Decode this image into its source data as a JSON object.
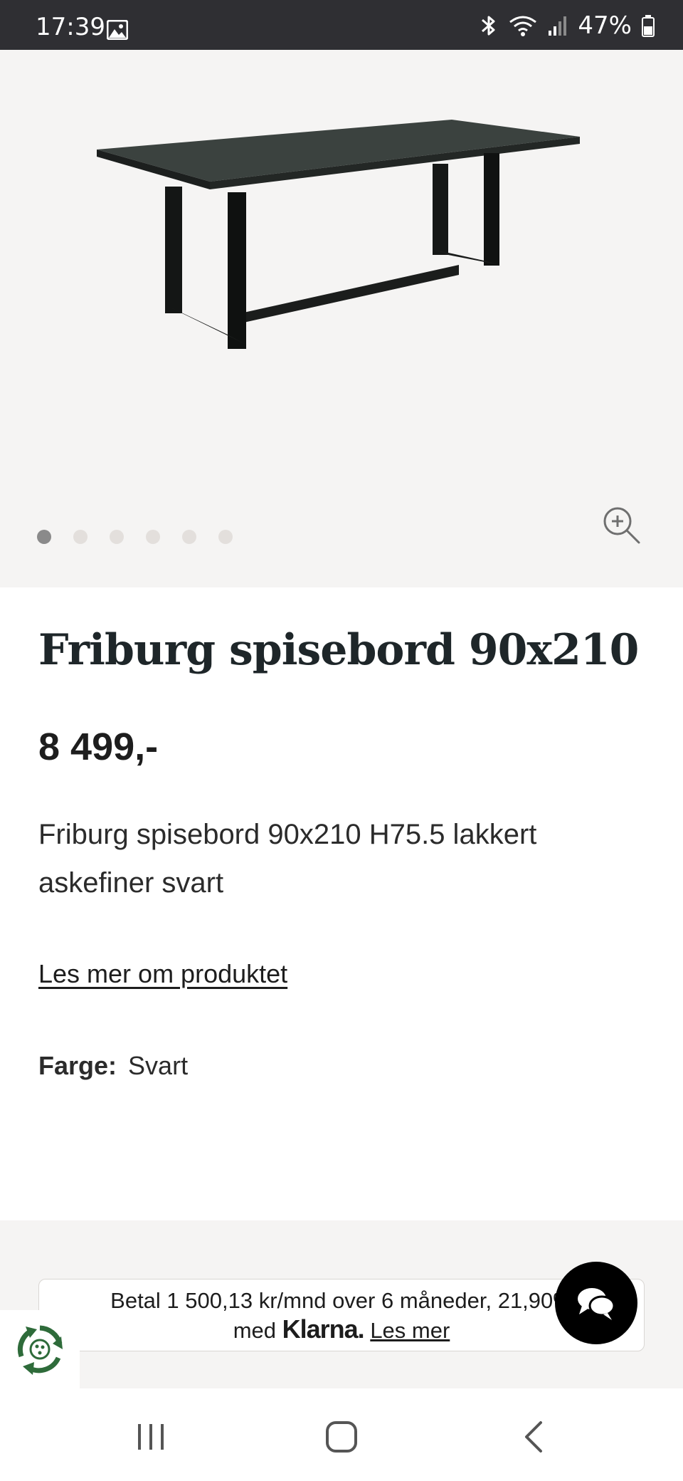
{
  "status_bar": {
    "time": "17:39",
    "battery": "47%",
    "icons": [
      "gallery-icon",
      "bluetooth-icon",
      "wifi-icon",
      "signal-icon",
      "battery-icon"
    ]
  },
  "gallery": {
    "image_alt": "Friburg spisebord",
    "image_count": 6,
    "active_index": 0,
    "zoom_icon": "zoom-in-icon"
  },
  "product": {
    "title": "Friburg spisebord 90x210",
    "price": "8 499,-",
    "description": "Friburg spisebord 90x210 H75.5 lakkert askefiner svart",
    "read_more": "Les mer om produktet",
    "color_label": "Farge:",
    "color_value": "Svart"
  },
  "klarna": {
    "line1": "Betal 1 500,13 kr/mnd over 6 måneder, 21,90%",
    "line2_prefix": "med",
    "logo": "Klarna.",
    "link": "Les mer"
  },
  "nav": {
    "icons": [
      "recent-apps-icon",
      "home-icon",
      "back-icon"
    ]
  },
  "colors": {
    "status_bar": "#2f2f33",
    "gallery_bg": "#f5f4f3",
    "title": "#1e2629",
    "chat_button": "#000000",
    "eco_green": "#2e6b3a"
  }
}
